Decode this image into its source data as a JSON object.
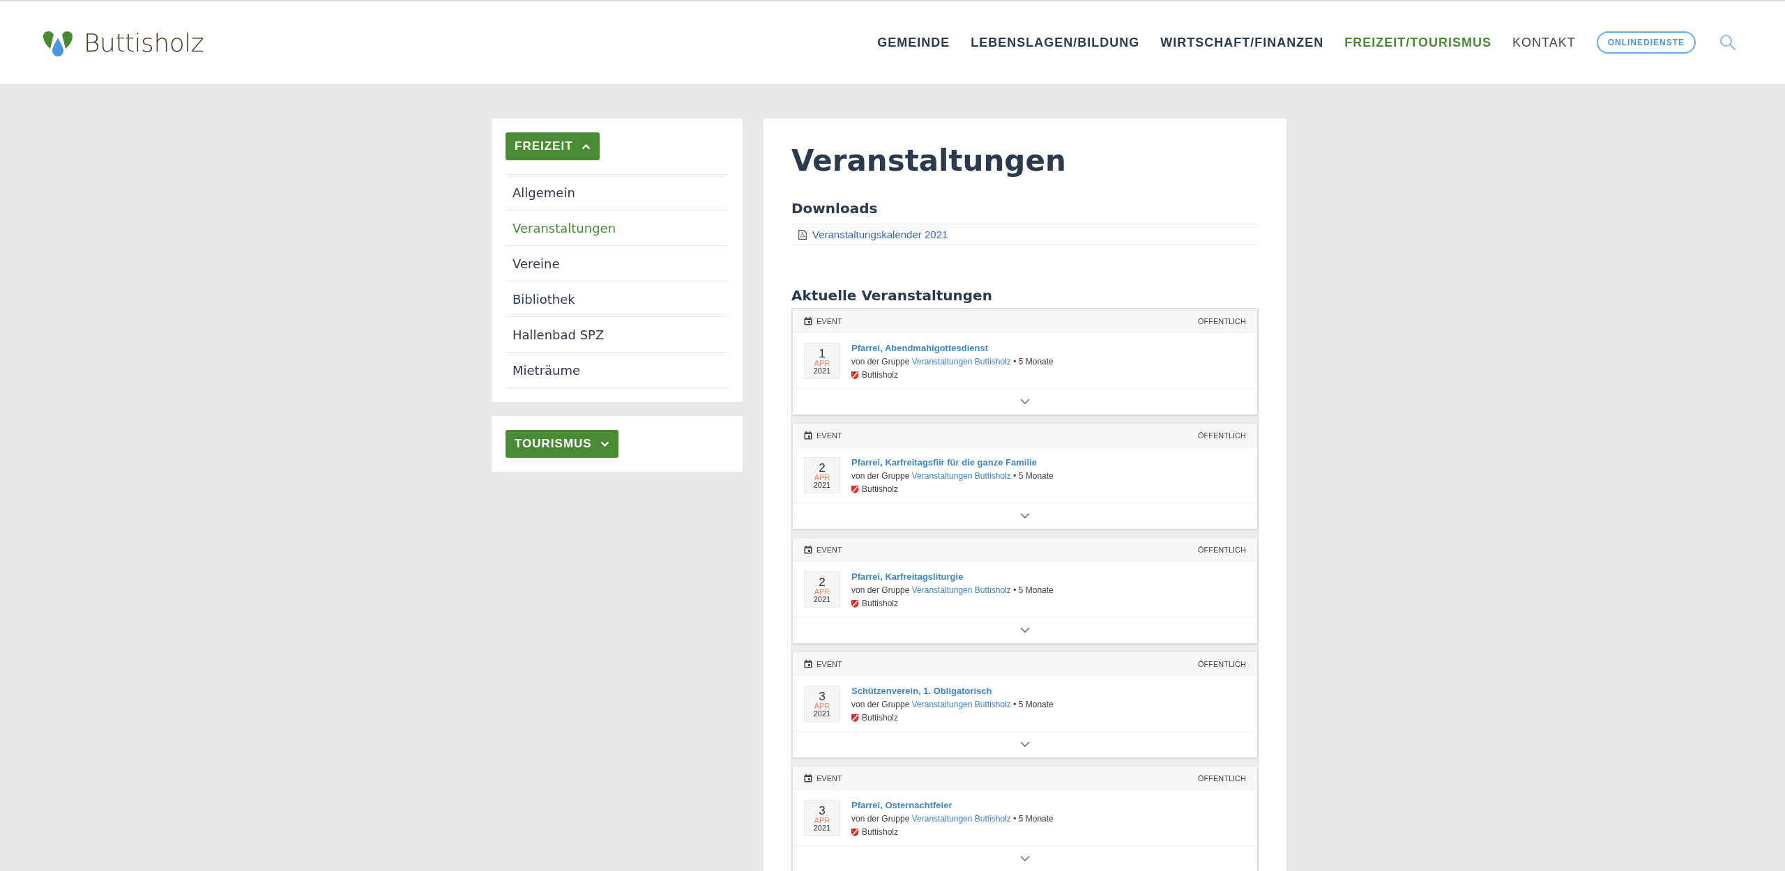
{
  "header": {
    "logo_text": "Buttisholz",
    "nav": [
      {
        "label": "GEMEINDE",
        "kind": "main",
        "selected": false
      },
      {
        "label": "LEBENSLAGEN/BILDUNG",
        "kind": "main",
        "selected": false
      },
      {
        "label": "WIRTSCHAFT/FINANZEN",
        "kind": "main",
        "selected": false
      },
      {
        "label": "FREIZEIT/TOURISMUS",
        "kind": "main",
        "selected": true
      },
      {
        "label": "KONTAKT",
        "kind": "light",
        "selected": false
      },
      {
        "label": "ONLINEDIENSTE",
        "kind": "pill",
        "selected": false
      }
    ]
  },
  "sidebar": {
    "sections": [
      {
        "label": "FREIZEIT",
        "expanded": true,
        "items": [
          {
            "label": "Allgemein",
            "selected": false
          },
          {
            "label": "Veranstaltungen",
            "selected": true
          },
          {
            "label": "Vereine",
            "selected": false
          },
          {
            "label": "Bibliothek",
            "selected": false
          },
          {
            "label": "Hallenbad SPZ",
            "selected": false
          },
          {
            "label": "Mieträume",
            "selected": false
          }
        ]
      },
      {
        "label": "TOURISMUS",
        "expanded": false
      }
    ]
  },
  "main": {
    "title": "Veranstaltungen",
    "downloads_heading": "Downloads",
    "downloads": [
      {
        "label": "Veranstaltungskalender 2021"
      }
    ],
    "events_heading": "Aktuelle Veranstaltungen",
    "events": [
      {
        "type": "EVENT",
        "visibility": "ÖFFENTLICH",
        "day": "1",
        "month": "APR",
        "year": "2021",
        "title": "Pfarrei, Abendmahlgottesdienst",
        "meta_prefix": "von der Gruppe",
        "group": "Veranstaltungen Buttisholz",
        "meta_suffix": "• 5 Monate",
        "location": "Buttisholz"
      },
      {
        "type": "EVENT",
        "visibility": "ÖFFENTLICH",
        "day": "2",
        "month": "APR",
        "year": "2021",
        "title": "Pfarrei, Karfreitagsfiir für die ganze Familie",
        "meta_prefix": "von der Gruppe",
        "group": "Veranstaltungen Buttisholz",
        "meta_suffix": "• 5 Monate",
        "location": "Buttisholz"
      },
      {
        "type": "EVENT",
        "visibility": "ÖFFENTLICH",
        "day": "2",
        "month": "APR",
        "year": "2021",
        "title": "Pfarrei, Karfreitagsliturgie",
        "meta_prefix": "von der Gruppe",
        "group": "Veranstaltungen Buttisholz",
        "meta_suffix": "• 5 Monate",
        "location": "Buttisholz"
      },
      {
        "type": "EVENT",
        "visibility": "ÖFFENTLICH",
        "day": "3",
        "month": "APR",
        "year": "2021",
        "title": "Schützenverein, 1. Obligatorisch",
        "meta_prefix": "von der Gruppe",
        "group": "Veranstaltungen Buttisholz",
        "meta_suffix": "• 5 Monate",
        "location": "Buttisholz"
      },
      {
        "type": "EVENT",
        "visibility": "ÖFFENTLICH",
        "day": "3",
        "month": "APR",
        "year": "2021",
        "title": "Pfarrei, Osternachtfeier",
        "meta_prefix": "von der Gruppe",
        "group": "Veranstaltungen Buttisholz",
        "meta_suffix": "• 5 Monate",
        "location": "Buttisholz"
      }
    ]
  }
}
